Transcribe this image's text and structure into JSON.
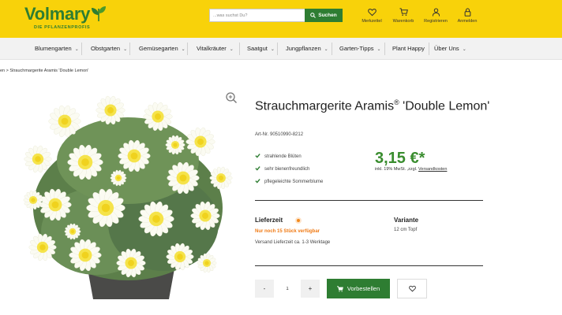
{
  "header": {
    "logo_text": "Volmary",
    "logo_tagline": "DIE PFLANZENPROFIS",
    "search_placeholder": "...was suchst Du?",
    "search_button": "Suchen",
    "icons": [
      {
        "label": "Merkzettel",
        "icon": "heart-icon"
      },
      {
        "label": "Warenkorb",
        "icon": "cart-icon"
      },
      {
        "label": "Registrieren",
        "icon": "user-icon"
      },
      {
        "label": "Anmelden",
        "icon": "lock-icon"
      }
    ]
  },
  "nav": {
    "items": [
      {
        "label": "Blumengarten",
        "chevron": true
      },
      {
        "label": "Obstgarten",
        "chevron": true
      },
      {
        "label": "Gemüsegarten",
        "chevron": true
      },
      {
        "label": "Vitalkräuter",
        "chevron": true
      },
      {
        "label": "Saatgut",
        "chevron": true
      },
      {
        "label": "Jungpflanzen",
        "chevron": true
      },
      {
        "label": "Garten-Tipps",
        "chevron": true
      },
      {
        "label": "Plant Happy",
        "chevron": false
      },
      {
        "label": "Über Uns",
        "chevron": true
      }
    ]
  },
  "breadcrumb": "en  >  Strauchmargerite Aramis 'Double Lemon'",
  "product": {
    "title_part1": "Strauchmargerite Aramis",
    "title_reg": "®",
    "title_part2": " 'Double Lemon'",
    "art_nr": "Art-Nr. 90510990-8212",
    "features": [
      "strahlende Blüten",
      "sehr bienenfreundlich",
      "pflegeleichte Sommerblume"
    ],
    "price": "3,15 €*",
    "price_note": "inkl. 19% MwSt. ,zzgl. ",
    "price_link": "Versandkosten",
    "delivery_label": "Lieferzeit",
    "stock_note": "Nur noch 15 Stück verfügbar",
    "shipping": "Versand Lieferzeit ca. 1-3 Werktage",
    "variant_label": "Variante",
    "variant_value": "12 cm Topf",
    "qty_minus": "-",
    "qty_value": "1",
    "qty_plus": "+",
    "order_button": "Vorbestellen"
  },
  "colors": {
    "header_bg": "#f8d20a",
    "brand_green": "#2e7d32",
    "price_green": "#3a8d2f",
    "stock_orange": "#f07a14"
  }
}
